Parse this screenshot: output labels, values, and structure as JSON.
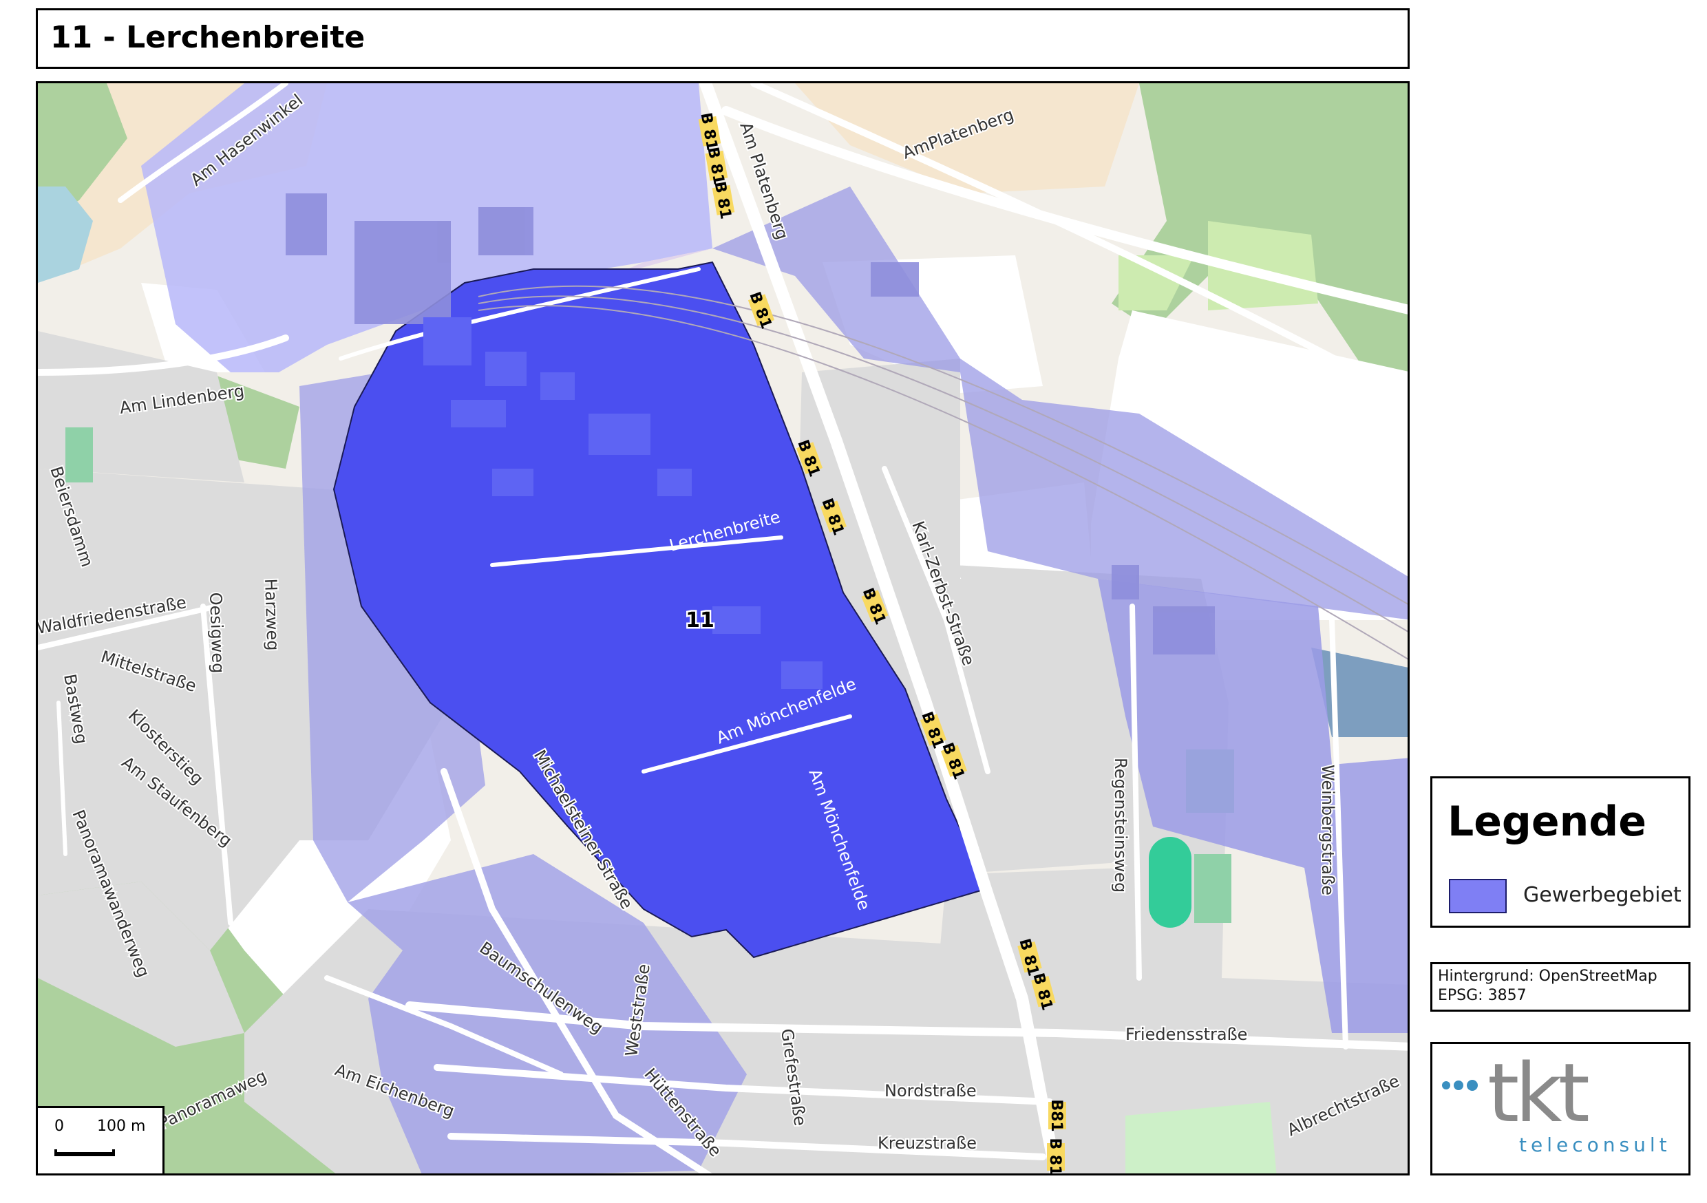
{
  "title": "11 - Lerchenbreite",
  "legend": {
    "title": "Legende",
    "items": [
      {
        "label": "Gewerbegebiet",
        "color": "#7f7ff4"
      }
    ]
  },
  "source": {
    "background": "Hintergrund: OpenStreetMap",
    "epsg": "EPSG: 3857"
  },
  "logo": {
    "name": "tkt",
    "subtitle": "teleconsult"
  },
  "scale": {
    "zero": "0",
    "length": "100 m"
  },
  "map": {
    "area_label": "11",
    "street_labels": [
      "Am Hasenwinkel",
      "Am Platenberg",
      "AmPlatenberg",
      "Am Lindenberg",
      "Lerchenbreite",
      "Am Mönchenfelde",
      "Am Mönchenfelde",
      "Karl-Zerbst-Straße",
      "Regensteinsweg",
      "Weinbergstraße",
      "Friedensstraße",
      "Nordstraße",
      "Kreuzstraße",
      "Albrechtstraße",
      "Grefestraße",
      "Hüttenstraße",
      "Weststraße",
      "Baumschulenweg",
      "Am Eichenberg",
      "Panoramaweg",
      "Panoramawanderweg",
      "Am Staufenberg",
      "Klosterstieg",
      "Mittelstraße",
      "Bastweg",
      "Waldfriedenstraße",
      "Oesigweg",
      "Harzweg",
      "Beiersdamm",
      "Michaelsteiner Straße"
    ],
    "road_shields": [
      "B 81",
      "B 81",
      "B 81",
      "B 81",
      "B 81",
      "B 81",
      "B 81",
      "B 81",
      "B 81",
      "B 81",
      "B 81",
      "B81",
      "B 81"
    ],
    "colors": {
      "area_main": "#4b4ff0",
      "area_light": "#b7b7f9",
      "area_mid": "#9b9be6",
      "road_shield": "#f8d960",
      "forest": "#a8d5a0",
      "field": "#f5e6cf",
      "residential": "#dcdcdc"
    }
  }
}
